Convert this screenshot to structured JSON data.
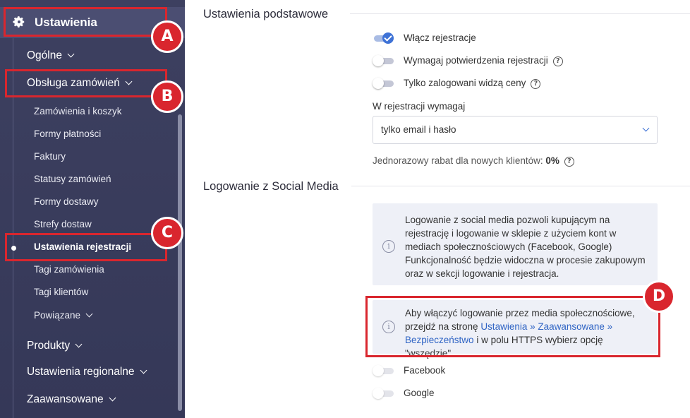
{
  "sidebar": {
    "header": {
      "icon": "gear-icon",
      "label": "Ustawienia"
    },
    "items": [
      {
        "label": "Ogólne"
      },
      {
        "label": "Obsługa zamówień"
      },
      {
        "label": "Zamówienia i koszyk"
      },
      {
        "label": "Formy płatności"
      },
      {
        "label": "Faktury"
      },
      {
        "label": "Statusy zamówień"
      },
      {
        "label": "Formy dostawy"
      },
      {
        "label": "Strefy dostaw"
      },
      {
        "label": "Ustawienia rejestracji"
      },
      {
        "label": "Tagi zamówienia"
      },
      {
        "label": "Tagi klientów"
      },
      {
        "label": "Powiązane"
      },
      {
        "label": "Produkty"
      },
      {
        "label": "Ustawienia regionalne"
      },
      {
        "label": "Zaawansowane"
      }
    ]
  },
  "annotations": {
    "a": "A",
    "b": "B",
    "c": "C",
    "d": "D"
  },
  "main": {
    "basic": {
      "title": "Ustawienia podstawowe",
      "toggles": [
        {
          "label": "Włącz rejestracje",
          "on": true
        },
        {
          "label": "Wymagaj potwierdzenia rejestracji",
          "on": false
        },
        {
          "label": "Tylko zalogowani widzą ceny",
          "on": false
        }
      ],
      "help_glyph": "?",
      "require_label": "W rejestracji wymagaj",
      "require_value": "tylko email i hasło",
      "discount_label": "Jednorazowy rabat dla nowych klientów:",
      "discount_value": "0%"
    },
    "social": {
      "title": "Logowanie z Social Media",
      "info_glyph": "i",
      "info1": "Logowanie z social media pozwoli kupującym na rejestrację i logowanie w sklepie z użyciem kont w mediach społecznościowych (Facebook, Google) Funkcjonalność będzie widoczna w procesie zakupowym oraz w sekcji logowanie i rejestracja.",
      "info2_before": "Aby włączyć logowanie przez media społecznościowe, przejdź na stronę ",
      "info2_link": "Ustawienia » Zaawansowane » Bezpieczeństwo",
      "info2_after": " i w polu HTTPS wybierz opcję \"wszędzie\".",
      "toggles": [
        {
          "label": "Facebook",
          "on": false
        },
        {
          "label": "Google",
          "on": false
        }
      ]
    }
  },
  "colors": {
    "sidebar_bg": "#3d4060",
    "annotation": "#d9262e",
    "accent": "#3e72d6",
    "info_bg": "#eef0f7"
  }
}
